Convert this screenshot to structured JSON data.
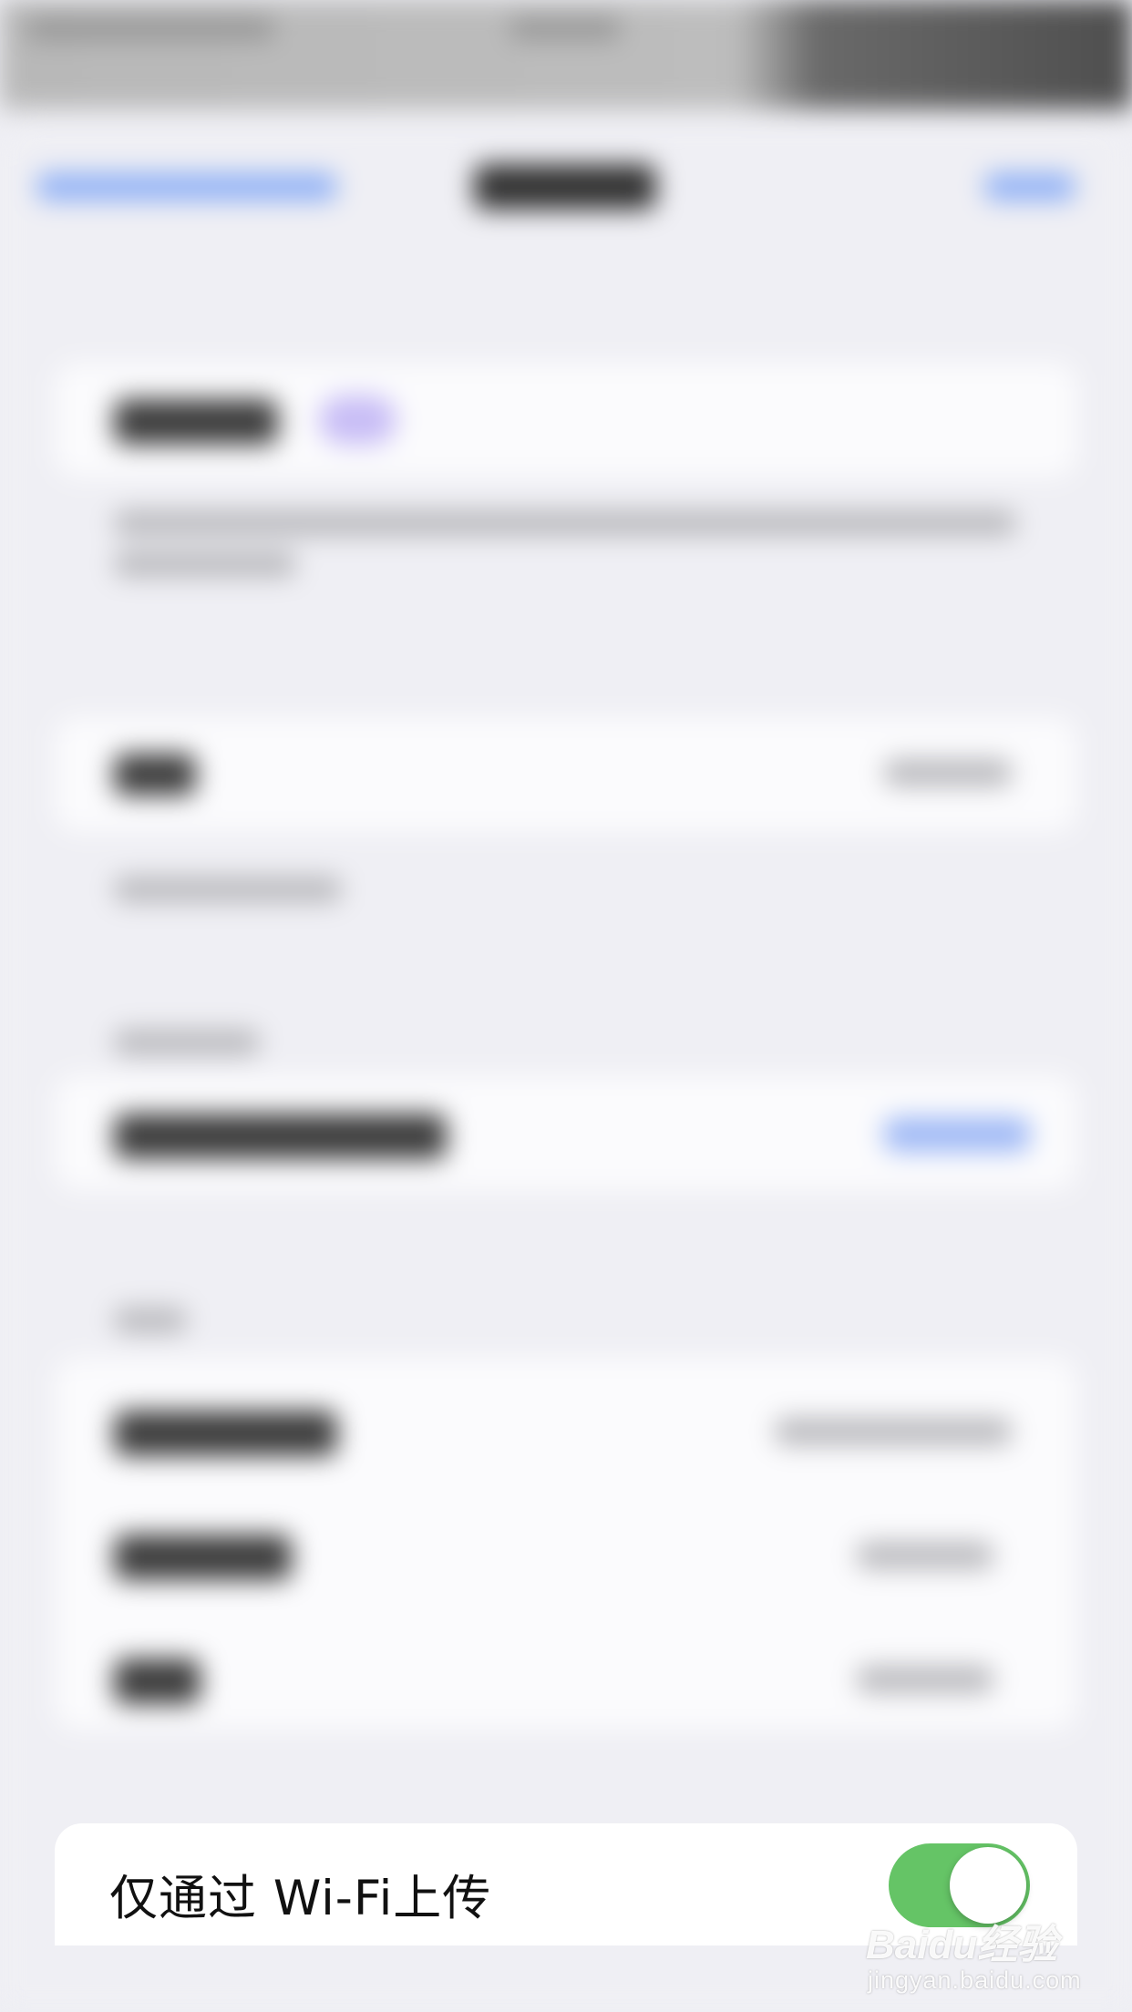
{
  "settings": {
    "wifi_only_upload": {
      "label": "仅通过 Wi-Fi上传",
      "enabled": true,
      "toggle_color": "#65c466"
    }
  },
  "watermark": {
    "logo": "Baidu经验",
    "url": "jingyan.baidu.com"
  }
}
